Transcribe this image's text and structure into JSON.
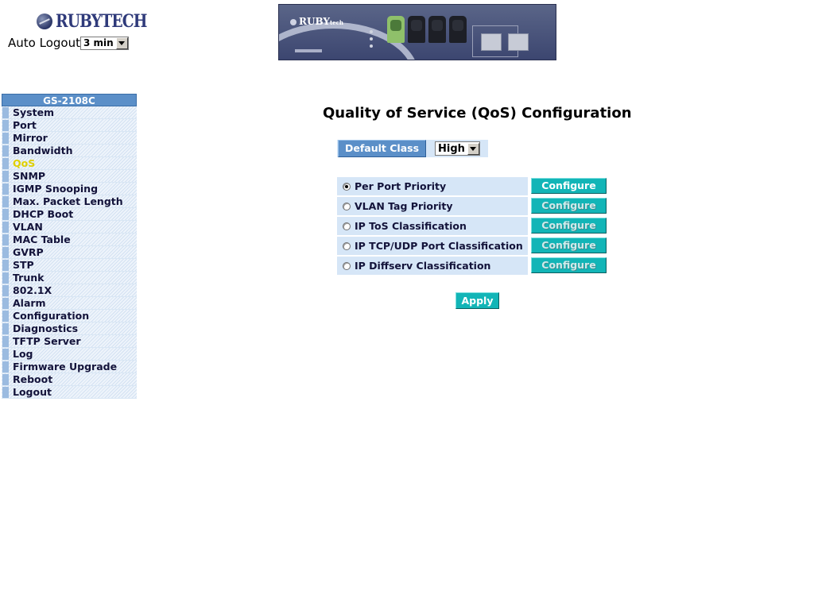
{
  "header": {
    "logo_text": "RUBYTECH",
    "auto_logout_label": "Auto Logout",
    "auto_logout_value": "3 min"
  },
  "sidebar": {
    "model": "GS-2108C",
    "items": [
      {
        "label": "System"
      },
      {
        "label": "Port"
      },
      {
        "label": "Mirror"
      },
      {
        "label": "Bandwidth"
      },
      {
        "label": "QoS"
      },
      {
        "label": "SNMP"
      },
      {
        "label": "IGMP Snooping"
      },
      {
        "label": "Max. Packet Length"
      },
      {
        "label": "DHCP Boot"
      },
      {
        "label": "VLAN"
      },
      {
        "label": "MAC Table"
      },
      {
        "label": "GVRP"
      },
      {
        "label": "STP"
      },
      {
        "label": "Trunk"
      },
      {
        "label": "802.1X"
      },
      {
        "label": "Alarm"
      },
      {
        "label": "Configuration"
      },
      {
        "label": "Diagnostics"
      },
      {
        "label": "TFTP Server"
      },
      {
        "label": "Log"
      },
      {
        "label": "Firmware Upgrade"
      },
      {
        "label": "Reboot"
      },
      {
        "label": "Logout"
      }
    ],
    "active_item": "QoS"
  },
  "main": {
    "title": "Quality of Service (QoS) Configuration",
    "default_class_label": "Default Class",
    "default_class_value": "High",
    "options": [
      {
        "label": "Per Port Priority",
        "button": "Configure",
        "selected": true
      },
      {
        "label": "VLAN Tag Priority",
        "button": "Configure",
        "selected": false
      },
      {
        "label": "IP ToS Classification",
        "button": "Configure",
        "selected": false
      },
      {
        "label": "IP TCP/UDP Port Classification",
        "button": "Configure",
        "selected": false
      },
      {
        "label": "IP Diffserv Classification",
        "button": "Configure",
        "selected": false
      }
    ],
    "apply_label": "Apply"
  },
  "colors": {
    "sidebar_header": "#5b8fc8",
    "active_menu": "#e0d000",
    "button": "#12b5b7",
    "row_background": "#d6e6f7"
  }
}
